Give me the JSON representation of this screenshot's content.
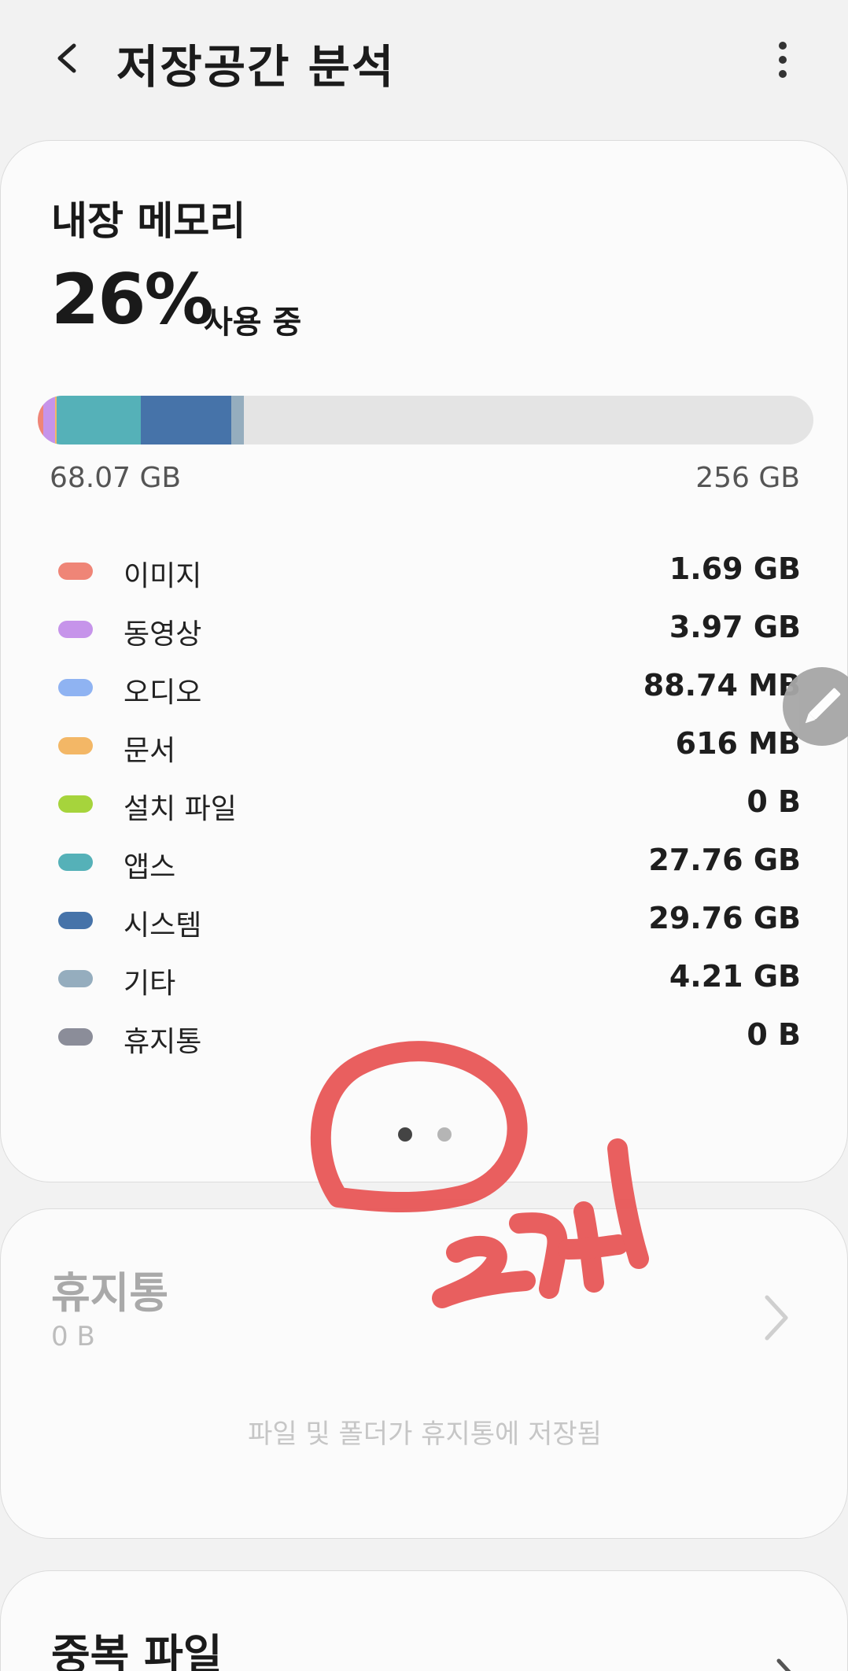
{
  "header": {
    "title": "저장공간 분석",
    "back_icon": "back-arrow-icon",
    "more_icon": "more-vertical-icon"
  },
  "internal_storage": {
    "title": "내장 메모리",
    "used_percent": "26%",
    "used_suffix": "사용 중",
    "used_amount": "68.07 GB",
    "total_amount": "256 GB",
    "usage_fraction": 0.26,
    "categories": [
      {
        "label": "이미지",
        "value": "1.69 GB",
        "color": "#ef8577"
      },
      {
        "label": "동영상",
        "value": "3.97 GB",
        "color": "#c694ea"
      },
      {
        "label": "오디오",
        "value": "88.74 MB",
        "color": "#8fb3f2"
      },
      {
        "label": "문서",
        "value": "616 MB",
        "color": "#f3b766"
      },
      {
        "label": "설치 파일",
        "value": "0 B",
        "color": "#a6d43c"
      },
      {
        "label": "앱스",
        "value": "27.76 GB",
        "color": "#55b1b8"
      },
      {
        "label": "시스템",
        "value": "29.76 GB",
        "color": "#4673a9"
      },
      {
        "label": "기타",
        "value": "4.21 GB",
        "color": "#95adbe"
      },
      {
        "label": "휴지통",
        "value": "0 B",
        "color": "#8b8d99"
      }
    ]
  },
  "pager": {
    "current": 1,
    "total": 2
  },
  "edit_icon": "pencil-icon",
  "trash_card": {
    "title": "휴지통",
    "size": "0 B",
    "note": "파일 및 폴더가 휴지통에 저장됨",
    "chevron_icon": "chevron-right-icon"
  },
  "duplicate_card": {
    "title": "중복 파일",
    "chevron_icon": "chevron-right-icon"
  },
  "annotation": {
    "text": "2개",
    "color": "#e85a5a"
  }
}
